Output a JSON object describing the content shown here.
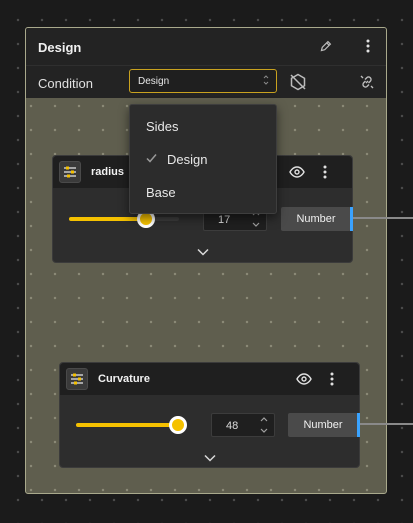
{
  "group": {
    "title": "Design",
    "condition_label": "Condition",
    "condition_value": "Design"
  },
  "dropdown": {
    "options": [
      {
        "label": "Sides",
        "selected": false
      },
      {
        "label": "Design",
        "selected": true
      },
      {
        "label": "Base",
        "selected": false
      }
    ]
  },
  "nodes": [
    {
      "title": "radius",
      "value": "17",
      "type": "Number",
      "slider_fraction": 0.7
    },
    {
      "title": "Curvature",
      "value": "48",
      "type": "Number",
      "slider_fraction": 1.0
    }
  ],
  "colors": {
    "accent_yellow": "#f5c100",
    "socket_blue": "#3aa3ff",
    "select_border": "#c9a21f",
    "group_fill": "#5f5e4e"
  },
  "icons": {
    "edit": "pencil-icon",
    "menu": "more-vertical-icon",
    "visibility": "eye-icon",
    "hide": "eye-off-hexagon-icon",
    "link": "link-icon",
    "node": "sliders-icon",
    "expand": "chevron-down-icon",
    "check": "check-icon"
  }
}
